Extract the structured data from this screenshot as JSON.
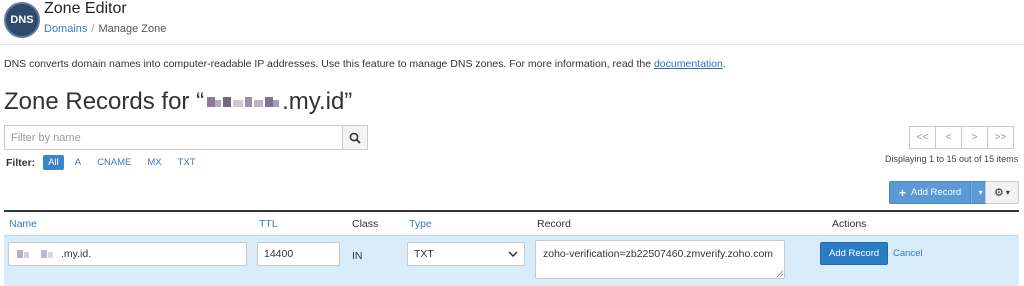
{
  "app": {
    "logo_text": "DNS",
    "title": "Zone Editor"
  },
  "breadcrumb": {
    "items": [
      {
        "label": "Domains"
      },
      {
        "label": "Manage Zone"
      }
    ],
    "separator": "/"
  },
  "intro": {
    "text": "DNS converts domain names into computer-readable IP addresses. Use this feature to manage DNS zones. For more information, read the ",
    "link_label": "documentation",
    "tail": "."
  },
  "zone": {
    "title_prefix": "Zone Records for “",
    "domain_suffix": ".my.id”"
  },
  "search": {
    "placeholder": "Filter by name",
    "value": ""
  },
  "filter": {
    "label": "Filter:",
    "options": [
      "All",
      "A",
      "CNAME",
      "MX",
      "TXT"
    ],
    "active": "All"
  },
  "pagination": {
    "buttons": [
      "<<",
      "<",
      ">",
      ">>"
    ],
    "info": "Displaying 1 to 15 out of 15 items"
  },
  "toolbar": {
    "add_record_label": "Add Record"
  },
  "table": {
    "columns": [
      "Name",
      "TTL",
      "Class",
      "Type",
      "Record",
      "Actions"
    ]
  },
  "edit_row": {
    "name_value": ".my.id.",
    "ttl_value": "14400",
    "class_value": "IN",
    "type_value": "TXT",
    "record_value": "zoho-verification=zb22507460.zmverify.zoho.com",
    "save_label": "Add Record",
    "cancel_label": "Cancel"
  },
  "colors": {
    "accent": "#3a7abf",
    "primary_button": "#2a7cc7",
    "edit_row_bg": "#d9ecf9"
  }
}
